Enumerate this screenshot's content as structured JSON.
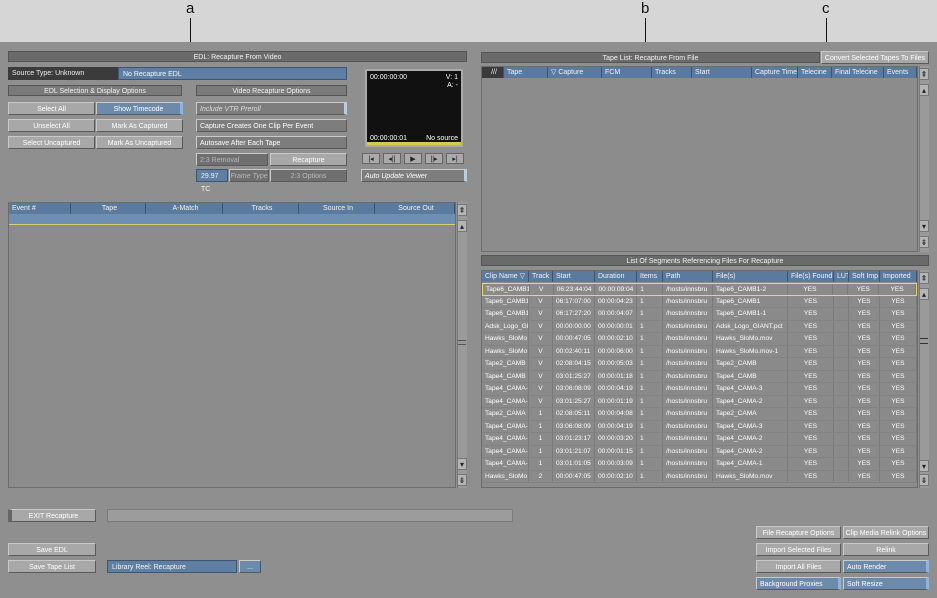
{
  "callouts": {
    "a": "a",
    "b": "b",
    "c": "c"
  },
  "edl": {
    "title": "EDL: Recapture From Video",
    "source_type": "Source Type: Unknown",
    "source_value": "No Recapture EDL",
    "selection_title": "EDL Selection & Display Options",
    "video_title": "Video Recapture Options",
    "select_all": "Select All",
    "show_timecode": "Show Timecode",
    "unselect_all": "Unselect All",
    "mark_captured": "Mark As Captured",
    "select_uncaptured": "Select Uncaptured",
    "mark_uncaptured": "Mark As Uncaptured",
    "vtr_preroll": "Include VTR Preroll",
    "clip_per_event": "Capture Creates One Clip Per Event",
    "autosave": "Autosave After Each Tape",
    "removal": "2:3 Removal",
    "recapture": "Recapture",
    "tc": "29.97 TC",
    "frame_type": "Frame Type",
    "options23": "2:3 Options",
    "columns": [
      "Event #",
      "Tape",
      "A-Match",
      "Tracks",
      "Source In",
      "Source Out"
    ]
  },
  "monitor": {
    "tc_top": "00:00:00:00",
    "v": "V: 1",
    "a": "A: -",
    "tc_bottom": "00:00:00:01",
    "no_source": "No source",
    "transport": [
      "|◂",
      "◂||",
      "▶",
      "||▸",
      "▸|"
    ],
    "auto_update": "Auto Update Viewer"
  },
  "tapelist": {
    "title": "Tape List: Recapture From File",
    "convert": "Convert Selected Tapes To Files",
    "columns": [
      "///",
      "Tape",
      "▽ Capture",
      "FCM",
      "Tracks",
      "Start",
      "Capture Time",
      "Telecine",
      "Final Telecine",
      "Events"
    ]
  },
  "segments": {
    "title": "List Of Segments Referencing Files For Recapture",
    "columns": [
      "Clip Name ▽",
      "Track",
      "Start",
      "Duration",
      "Items",
      "Path",
      "File(s)",
      "File(s) Found",
      "LUT",
      "Soft Imp",
      "Imported"
    ],
    "rows": [
      [
        "Tape6_CAMB1",
        "V",
        "06:23:44:04",
        "00:00:09:04",
        "1",
        "/hosts/innsbru",
        "Tape6_CAMB1-2",
        "YES",
        "",
        "YES",
        "YES"
      ],
      [
        "Tape6_CAMB1",
        "V",
        "06:17:07:00",
        "00:00:04:23",
        "1",
        "/hosts/innsbru",
        "Tape6_CAMB1",
        "YES",
        "",
        "YES",
        "YES"
      ],
      [
        "Tape6_CAMB1",
        "V",
        "06:17:27:20",
        "00:00:04:07",
        "1",
        "/hosts/innsbru",
        "Tape6_CAMB1-1",
        "YES",
        "",
        "YES",
        "YES"
      ],
      [
        "Adsk_Logo_GI",
        "V",
        "00:00:00:00",
        "00:00:00:01",
        "1",
        "/hosts/innsbru",
        "Adsk_Logo_GIANT.pct",
        "YES",
        "",
        "YES",
        "YES"
      ],
      [
        "Hawks_SloMo",
        "V",
        "00:00:47:05",
        "00:00:02:10",
        "1",
        "/hosts/innsbru",
        "Hawks_SloMo.mov",
        "YES",
        "",
        "YES",
        "YES"
      ],
      [
        "Hawks_SloMo",
        "V",
        "00:02:40:11",
        "00:00:06:00",
        "1",
        "/hosts/innsbru",
        "Hawks_SloMo.mov-1",
        "YES",
        "",
        "YES",
        "YES"
      ],
      [
        "Tape2_CAMB",
        "V",
        "02:08:04:15",
        "00:00:05:03",
        "1",
        "/hosts/innsbru",
        "Tape2_CAMB",
        "YES",
        "",
        "YES",
        "YES"
      ],
      [
        "Tape4_CAMB",
        "V",
        "03:01:25:27",
        "00:00:01:18",
        "1",
        "/hosts/innsbru",
        "Tape4_CAMB",
        "YES",
        "",
        "YES",
        "YES"
      ],
      [
        "Tape4_CAMA-",
        "V",
        "03:06:08:09",
        "00:00:04:19",
        "1",
        "/hosts/innsbru",
        "Tape4_CAMA-3",
        "YES",
        "",
        "YES",
        "YES"
      ],
      [
        "Tape4_CAMA-",
        "V",
        "03:01:25:27",
        "00:00:01:19",
        "1",
        "/hosts/innsbru",
        "Tape4_CAMA-2",
        "YES",
        "",
        "YES",
        "YES"
      ],
      [
        "Tape2_CAMA",
        "1",
        "02:08:05:11",
        "00:00:04:08",
        "1",
        "/hosts/innsbru",
        "Tape2_CAMA",
        "YES",
        "",
        "YES",
        "YES"
      ],
      [
        "Tape4_CAMA-",
        "1",
        "03:06:08:09",
        "00:00:04:19",
        "1",
        "/hosts/innsbru",
        "Tape4_CAMA-3",
        "YES",
        "",
        "YES",
        "YES"
      ],
      [
        "Tape4_CAMA-",
        "1",
        "03:01:23:17",
        "00:00:03:20",
        "1",
        "/hosts/innsbru",
        "Tape4_CAMA-2",
        "YES",
        "",
        "YES",
        "YES"
      ],
      [
        "Tape4_CAMA-",
        "1",
        "03:01:21:07",
        "00:00:01:15",
        "1",
        "/hosts/innsbru",
        "Tape4_CAMA-2",
        "YES",
        "",
        "YES",
        "YES"
      ],
      [
        "Tape4_CAMA-",
        "1",
        "03:01:01:05",
        "00:00:03:09",
        "1",
        "/hosts/innsbru",
        "Tape4_CAMA-1",
        "YES",
        "",
        "YES",
        "YES"
      ],
      [
        "Hawks_SloMo",
        "2",
        "00:00:47:05",
        "00:00:02:10",
        "1",
        "/hosts/innsbru",
        "Hawks_SloMo.mov",
        "YES",
        "",
        "YES",
        "YES"
      ]
    ]
  },
  "bottom": {
    "exit": "EXIT Recapture",
    "save_edl": "Save EDL",
    "save_tape_list": "Save Tape List",
    "library_reel": "Library Reel: Recapture",
    "browse": "...",
    "file_recapture_options": "File Recapture Options",
    "clip_media_relink_options": "Clip Media Relink Options",
    "import_selected": "Import Selected Files",
    "relink": "Relink",
    "import_all": "Import All Files",
    "auto_render": "Auto Render",
    "background_proxies": "Background Proxies",
    "soft_resize": "Soft Resize"
  }
}
